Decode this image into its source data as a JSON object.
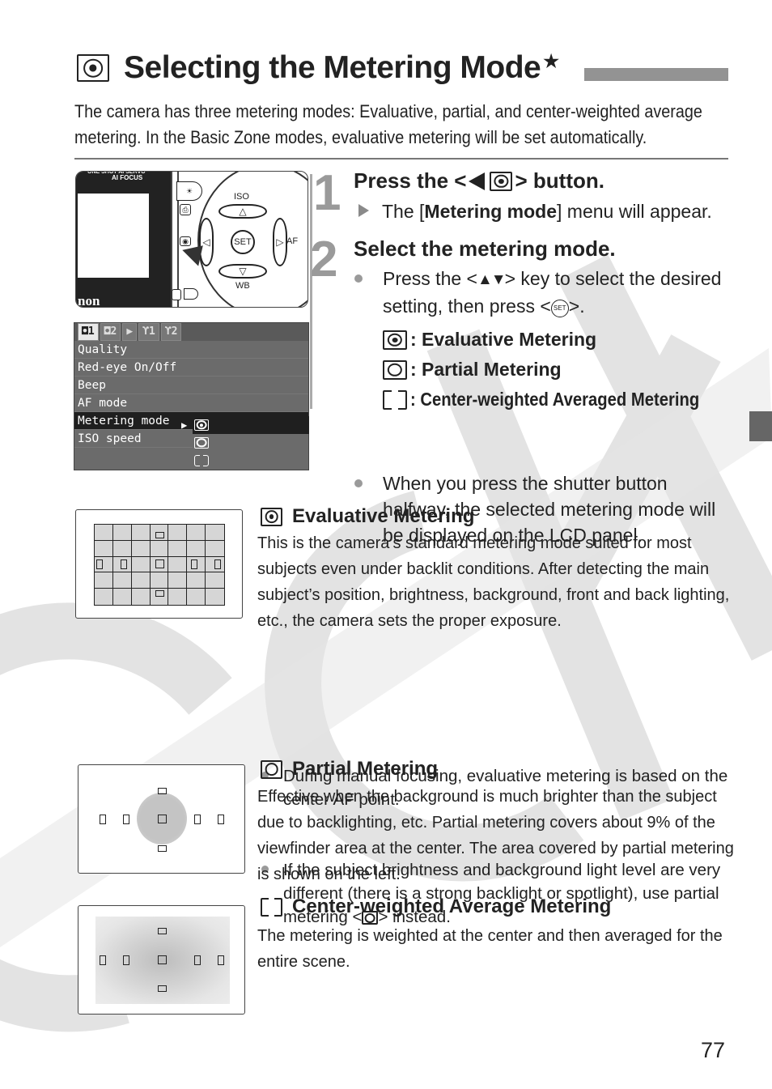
{
  "page": {
    "title": "Selecting the Metering Mode",
    "title_mark": "★",
    "intro": "The camera has three metering modes: Evaluative, partial, and center-weighted average metering. In the Basic Zone modes, evaluative metering will be set automatically.",
    "page_number": "77"
  },
  "camera_image": {
    "lcd_top_label": "ONE SHOT   AI SERVO",
    "lcd_label": "AI FOCUS",
    "brand_fragment": "non",
    "key_up": "ISO",
    "key_down": "WB",
    "key_right": "AF",
    "key_center": "SET"
  },
  "lcd_menu": {
    "tabs": [
      "◘1",
      "◘2",
      "▶",
      "ϒ1",
      "ϒ2"
    ],
    "active_tab": 0,
    "items": [
      "Quality",
      "Red-eye On/Off",
      "Beep",
      "AF mode",
      "Metering mode",
      "ISO speed"
    ],
    "selected_item": 4,
    "options": [
      "evaluative-icon",
      "partial-icon",
      "center-weighted-icon"
    ],
    "selected_option": 0
  },
  "steps": [
    {
      "number": "1",
      "title_prefix": "Press the <",
      "title_suffix": "> button.",
      "result_prefix": "The [",
      "result_bold": "Metering mode",
      "result_suffix": "] menu will appear."
    },
    {
      "number": "2",
      "title": "Select the metering mode.",
      "bullet1_prefix": "Press the <",
      "bullet1_keys": "▲▼",
      "bullet1_middle": "> key to select the desired setting, then press <",
      "bullet1_set": "SET",
      "bullet1_suffix": ">.",
      "modes": [
        {
          "icon": "evaluative-icon",
          "label": ": Evaluative Metering"
        },
        {
          "icon": "partial-icon",
          "label": ": Partial Metering"
        },
        {
          "icon": "center-weighted-icon",
          "label": ": Center-weighted Averaged Metering"
        }
      ],
      "bullet2": "When you press the shutter button halfway, the selected metering mode will be displayed on the LCD panel."
    }
  ],
  "sections": {
    "evaluative": {
      "heading": "Evaluative Metering",
      "body": "This is the camera’s standard metering mode suited for most subjects even under backlit conditions. After detecting the main subject’s position, brightness, background, front and back lighting, etc., the camera sets the proper exposure.",
      "bullets": [
        "During manual focusing, evaluative metering is based on the center AF point.",
        "If the subject brightness and background light level are very different (there is a strong backlight or spotlight), use partial metering <"
      ],
      "bullet2_suffix": "> instead."
    },
    "partial": {
      "heading": "Partial Metering",
      "body": "Effective when the background is much brighter than the subject due to backlighting, etc. Partial metering covers about 9% of the viewfinder area at the center. The area covered by partial metering is shown on the left."
    },
    "center_weighted": {
      "heading": "Center-weighted Average Metering",
      "body": "The metering is weighted at the center and then averaged for the entire scene."
    }
  },
  "colors": {
    "text": "#222222",
    "step_number": "#9a9a9a",
    "title_bar": "#939393",
    "side_tab": "#666666",
    "watermark": "#e2e2e2"
  }
}
